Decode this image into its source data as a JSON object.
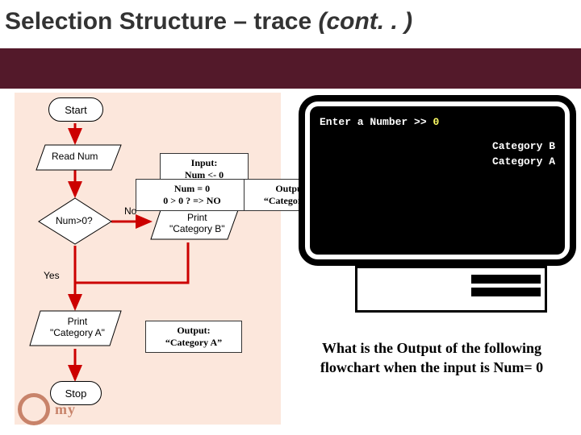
{
  "title_prefix": "Selection Structure – trace ",
  "title_ital": "(cont. . )",
  "flow": {
    "start": "Start",
    "read": "Read Num",
    "decision": "Num>0?",
    "yes": "Yes",
    "no": "No",
    "printA": "Print\n\"Category A\"",
    "printB": "Print\n\"Category B\"",
    "stop": "Stop"
  },
  "console": {
    "prompt_prefix": "Enter a Number >> ",
    "prompt_value": "0",
    "out1": "Category B",
    "out2": "Category A"
  },
  "annotations": {
    "input_line1": "Input:",
    "input_line2": "Num <- 0",
    "cond_line1": "Num = 0",
    "cond_line2": "0 > 0 ?   => NO",
    "outB_line1": "Output:",
    "outB_line2": "“Category B”",
    "outA_line1": "Output:",
    "outA_line2": "“Category A”"
  },
  "question": "What is the Output of the following flowchart when the input is  Num= 0",
  "watermark": "my"
}
